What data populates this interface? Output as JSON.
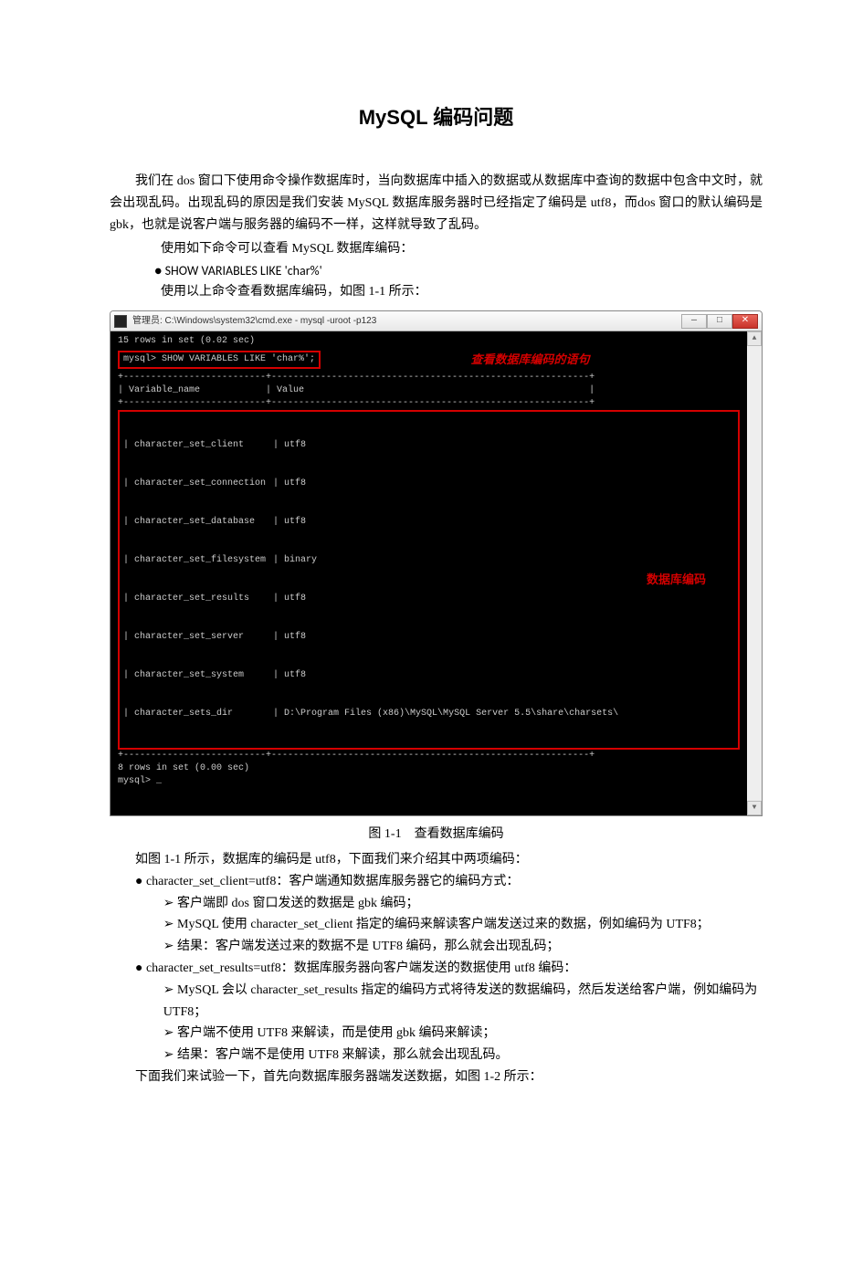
{
  "title": "MySQL 编码问题",
  "para1": "我们在 dos 窗口下使用命令操作数据库时，当向数据库中插入的数据或从数据库中查询的数据中包含中文时，就会出现乱码。出现乱码的原因是我们安装 MySQL 数据库服务器时已经指定了编码是 utf8，而dos 窗口的默认编码是 gbk，也就是说客户端与服务器的编码不一样，这样就导致了乱码。",
  "para2": "使用如下命令可以查看 MySQL 数据库编码：",
  "cmd1": "SHOW  VARIABLES  LIKE  'char%'",
  "para3": "使用以上命令查看数据库编码，如图 1-1 所示：",
  "window": {
    "title": "管理员: C:\\Windows\\system32\\cmd.exe - mysql  -uroot -p123",
    "min": "—",
    "max": "□",
    "close": "✕"
  },
  "terminal": {
    "line1": "15 rows in set (0.02 sec)",
    "blank": "",
    "query_prompt": "mysql> SHOW VARIABLES LIKE 'char%';",
    "query_label": "查看数据库编码的语句",
    "sep": "+--------------------------+----------------------------------------------------------+",
    "header_row": "| Variable_name            | Value                                                    |",
    "data_label": "数据库编码",
    "vars": [
      "| character_set_client",
      "| character_set_connection",
      "| character_set_database",
      "| character_set_filesystem",
      "| character_set_results",
      "| character_set_server",
      "| character_set_system",
      "| character_sets_dir"
    ],
    "vals": [
      "| utf8",
      "| utf8",
      "| utf8",
      "| binary",
      "| utf8",
      "| utf8",
      "| utf8",
      "| D:\\Program Files (x86)\\MySQL\\MySQL Server 5.5\\share\\charsets\\"
    ],
    "footer1": "8 rows in set (0.00 sec)",
    "footer2": "mysql> _"
  },
  "caption1": "图 1-1　查看数据库编码",
  "para4": "如图 1-1 所示，数据库的编码是 utf8，下面我们来介绍其中两项编码：",
  "b1": "character_set_client=utf8：客户端通知数据库服务器它的编码方式：",
  "b1a": "客户端即 dos 窗口发送的数据是 gbk 编码；",
  "b1b": "MySQL 使用 character_set_client 指定的编码来解读客户端发送过来的数据，例如编码为 UTF8；",
  "b1c": "结果：客户端发送过来的数据不是 UTF8 编码，那么就会出现乱码；",
  "b2": "character_set_results=utf8：数据库服务器向客户端发送的数据使用 utf8 编码：",
  "b2a": "MySQL 会以 character_set_results 指定的编码方式将待发送的数据编码，然后发送给客户端，例如编码为 UTF8；",
  "b2b": "客户端不使用 UTF8 来解读，而是使用 gbk 编码来解读；",
  "b2c": "结果：客户端不是使用 UTF8 来解读，那么就会出现乱码。",
  "para5": "下面我们来试验一下，首先向数据库服务器端发送数据，如图 1-2 所示："
}
